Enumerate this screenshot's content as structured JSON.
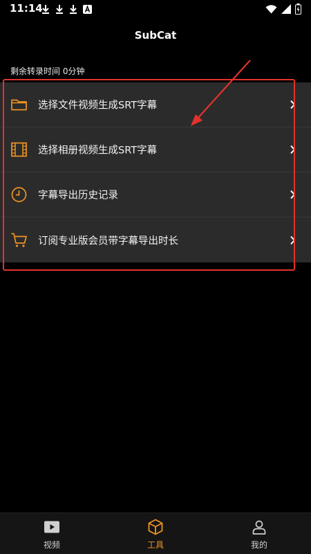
{
  "status_bar": {
    "time": "11:14",
    "left_icons": [
      "download-icon",
      "download-icon",
      "download-icon",
      "a-badge-icon"
    ],
    "right_icons": [
      "wifi-icon",
      "signal-icon",
      "battery-icon"
    ]
  },
  "header": {
    "title": "SubCat"
  },
  "remaining": {
    "text": "剩余转录时间 0分钟"
  },
  "menu": {
    "items": [
      {
        "icon": "folder-icon",
        "label": "选择文件视频生成SRT字幕"
      },
      {
        "icon": "film-icon",
        "label": "选择相册视频生成SRT字幕"
      },
      {
        "icon": "clock-icon",
        "label": "字幕导出历史记录"
      },
      {
        "icon": "cart-icon",
        "label": "订阅专业版会员带字幕导出时长"
      }
    ]
  },
  "tabbar": {
    "tabs": [
      {
        "icon": "video-play-icon",
        "label": "视频",
        "active": false
      },
      {
        "icon": "cube-icon",
        "label": "工具",
        "active": true
      },
      {
        "icon": "user-icon",
        "label": "我的",
        "active": false
      }
    ]
  },
  "colors": {
    "accent": "#f29422",
    "background": "#000000",
    "card": "#2b2b2b",
    "annotation": "#e4322b"
  }
}
